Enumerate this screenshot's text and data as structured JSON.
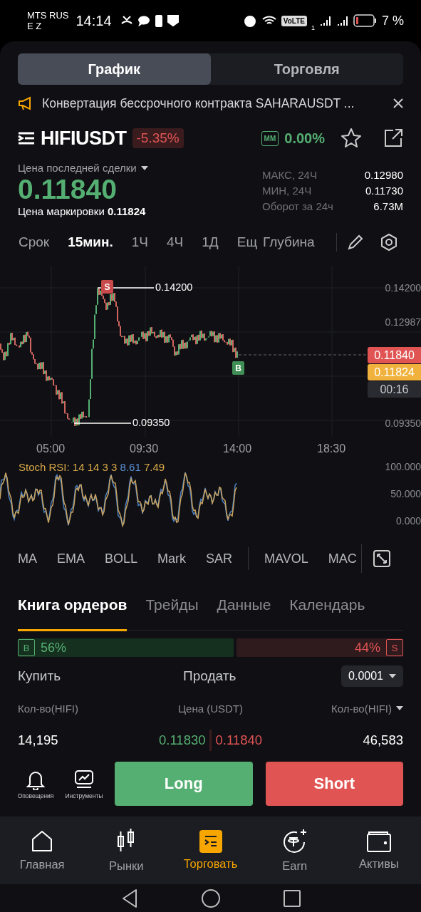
{
  "status_bar": {
    "carrier": "MTS RUS",
    "carrier_line2": "E Z",
    "time": "14:14",
    "volte": "VoLTE",
    "sim_index": "1",
    "battery": "7 %"
  },
  "view_tabs": [
    {
      "label": "График",
      "selected": true
    },
    {
      "label": "Торговля",
      "selected": false
    }
  ],
  "notice": {
    "text": "Конвертация бессрочного контракта SAHARAUSDT ..."
  },
  "symbol": {
    "name": "HIFIUSDT",
    "change": "-5.35%",
    "mm_badge": "MM",
    "mm_value": "0.00%"
  },
  "price": {
    "label": "Цена последней сделки",
    "last": "0.11840",
    "mark_label": "Цена маркировки",
    "mark": "0.11824",
    "stats": [
      {
        "label": "МАКС, 24Ч",
        "value": "0.12980"
      },
      {
        "label": "МИН, 24Ч",
        "value": "0.11730"
      },
      {
        "label": "Оборот за 24ч",
        "value": "6.73M"
      }
    ]
  },
  "intervals": [
    {
      "label": "Срок",
      "selected": false
    },
    {
      "label": "15мин.",
      "selected": true
    },
    {
      "label": "1Ч",
      "selected": false
    },
    {
      "label": "4Ч",
      "selected": false
    },
    {
      "label": "1Д",
      "selected": false
    },
    {
      "label": "Ещ",
      "selected": false
    },
    {
      "label": "Глубина",
      "selected": false
    }
  ],
  "price_chart": {
    "high_marker": "0.14200",
    "low_marker": "0.09350",
    "trade_sell": "S",
    "trade_buy": "B",
    "y_labels": [
      "0.14200",
      "0.12987",
      "0.09350"
    ],
    "last_price_tag": "0.11840",
    "mark_price_tag": "0.11824",
    "countdown": "00:16",
    "x_labels": [
      "05:00",
      "09:30",
      "14:00",
      "18:30"
    ]
  },
  "stoch_rsi": {
    "label": "Stoch RSI: 14 14 3 3",
    "k": "8.61",
    "d": "7.49",
    "y_labels": [
      "100.000",
      "50.000",
      "0.000"
    ]
  },
  "indicators": [
    [
      "MA",
      "EMA",
      "BOLL",
      "Mark",
      "SAR"
    ],
    [
      "MAVOL",
      "MAC"
    ]
  ],
  "book_tabs": [
    {
      "label": "Книга ордеров",
      "selected": true
    },
    {
      "label": "Трейды",
      "selected": false
    },
    {
      "label": "Данные",
      "selected": false
    },
    {
      "label": "Календарь",
      "selected": false
    }
  ],
  "ratio": {
    "buy_badge": "B",
    "buy_pct": "56%",
    "sell_pct": "44%",
    "sell_badge": "S"
  },
  "book_header": {
    "buy": "Купить",
    "sell": "Продать",
    "precision": "0.0001"
  },
  "columns": [
    "Кол-во(HIFI)",
    "Цена (USDT)",
    "Кол-во(HIFI)"
  ],
  "rows": [
    {
      "bid_qty": "14,195",
      "bid_price": "0.11830",
      "ask_price": "0.11840",
      "ask_qty": "46,583"
    }
  ],
  "tools": [
    {
      "label": "Оповещения",
      "kind": "alerts"
    },
    {
      "label": "Инструменты",
      "kind": "tools"
    }
  ],
  "actions": [
    {
      "label": "Long",
      "kind": "long"
    },
    {
      "label": "Short",
      "kind": "short"
    }
  ],
  "nav": [
    {
      "label": "Главная",
      "selected": false,
      "kind": "home"
    },
    {
      "label": "Рынки",
      "selected": false,
      "kind": "markets"
    },
    {
      "label": "Торговать",
      "selected": true,
      "kind": "trade"
    },
    {
      "label": "Earn",
      "selected": false,
      "kind": "earn"
    },
    {
      "label": "Активы",
      "selected": false,
      "kind": "assets"
    }
  ]
}
